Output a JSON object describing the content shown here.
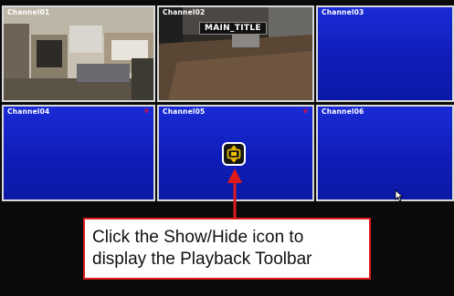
{
  "channels": [
    {
      "label": "Channel01",
      "feed": "office-room"
    },
    {
      "label": "Channel02",
      "feed": "hallway-floor",
      "overlay_title": "MAIN_TITLE"
    },
    {
      "label": "Channel03"
    },
    {
      "label": "Channel04",
      "mark": "v"
    },
    {
      "label": "Channel05",
      "mark": "v"
    },
    {
      "label": "Channel06"
    }
  ],
  "toggle_button": {
    "icon": "show-hide-toolbar-icon"
  },
  "callout": {
    "line1": "Click the Show/Hide icon to",
    "line2": "display the Playback Toolbar"
  },
  "colors": {
    "channel_bg": "#1520c8",
    "grid_border": "#d8d8d8",
    "callout_border": "#e11b1b",
    "arrow": "#e11b1b",
    "icon_accent": "#f5c400",
    "vmark": "#e0103a"
  }
}
